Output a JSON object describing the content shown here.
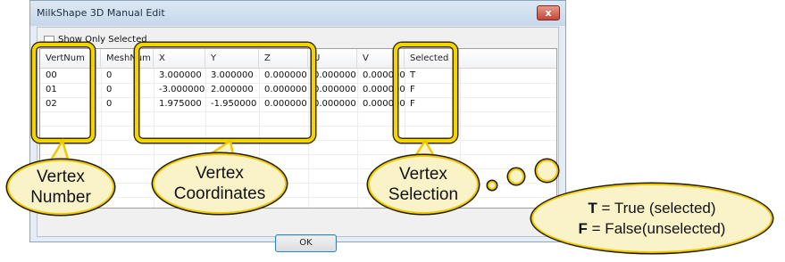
{
  "window": {
    "title": "MilkShape 3D Manual Edit",
    "close_label": "x"
  },
  "checkbox": {
    "label": "Show Only Selected",
    "checked": false
  },
  "table": {
    "columns": [
      "VertNum",
      "MeshNum",
      "X",
      "Y",
      "Z",
      "U",
      "V",
      "Selected"
    ],
    "rows": [
      [
        "00",
        "0",
        "3.000000",
        "3.000000",
        "0.000000",
        "0.000000",
        "0.000000",
        "T"
      ],
      [
        "01",
        "0",
        "-3.000000",
        "2.000000",
        "0.000000",
        "0.000000",
        "0.000000",
        "F"
      ],
      [
        "02",
        "0",
        "1.975000",
        "-1.950000",
        "0.000000",
        "0.000000",
        "0.000000",
        "F"
      ]
    ]
  },
  "ok_label": "OK",
  "callouts": {
    "vertex_number": [
      "Vertex",
      "Number"
    ],
    "vertex_coordinates": [
      "Vertex",
      "Coordinates"
    ],
    "vertex_selection": [
      "Vertex",
      "Selection"
    ]
  },
  "legend": {
    "true_key": "T",
    "true_text": " = True (selected)",
    "false_key": "F",
    "false_text": " = False(unselected)"
  },
  "colors": {
    "highlight": "#f3d400",
    "bubble_fill": "#fbf3c8"
  }
}
